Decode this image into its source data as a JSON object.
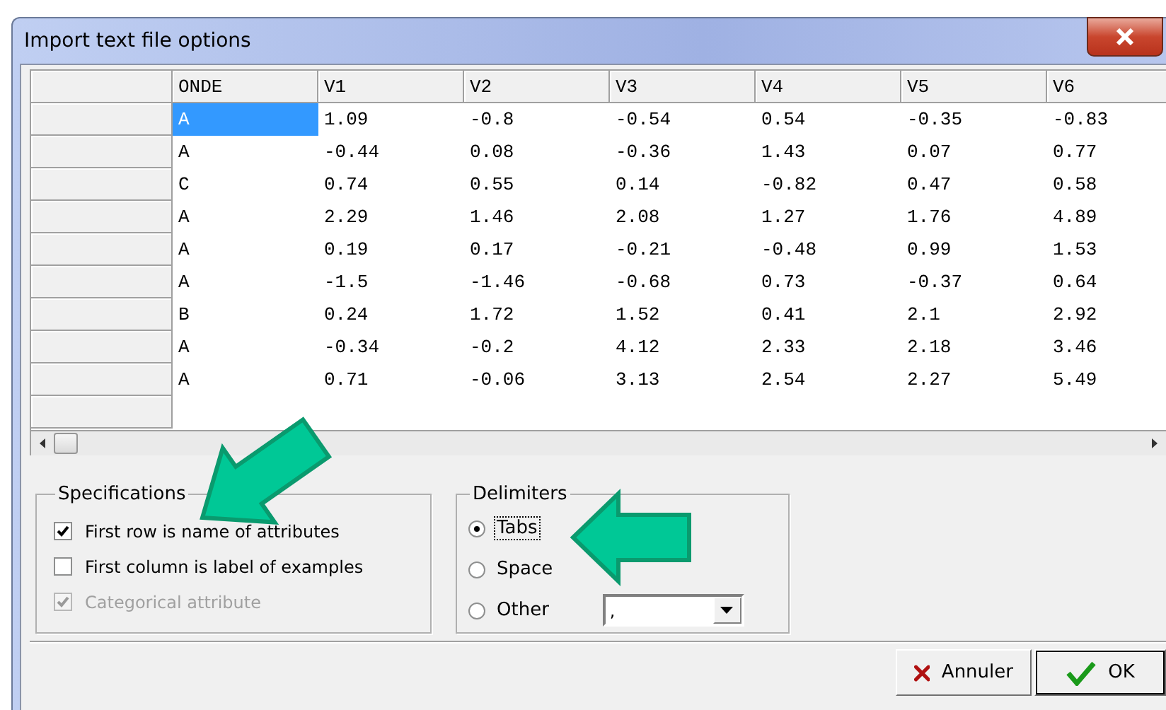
{
  "window": {
    "title": "Import text file options"
  },
  "table": {
    "columns": [
      "ONDE",
      "V1",
      "V2",
      "V3",
      "V4",
      "V5",
      "V6"
    ],
    "rows": [
      {
        "onde": "A",
        "selected": true,
        "values": [
          "1.09",
          "-0.8",
          "-0.54",
          "0.54",
          "-0.35",
          "-0.83"
        ]
      },
      {
        "onde": "A",
        "selected": false,
        "values": [
          "-0.44",
          "0.08",
          "-0.36",
          "1.43",
          "0.07",
          "0.77"
        ]
      },
      {
        "onde": "C",
        "selected": false,
        "values": [
          "0.74",
          "0.55",
          "0.14",
          "-0.82",
          "0.47",
          "0.58"
        ]
      },
      {
        "onde": "A",
        "selected": false,
        "values": [
          "2.29",
          "1.46",
          "2.08",
          "1.27",
          "1.76",
          "4.89"
        ]
      },
      {
        "onde": "A",
        "selected": false,
        "values": [
          "0.19",
          "0.17",
          "-0.21",
          "-0.48",
          "0.99",
          "1.53"
        ]
      },
      {
        "onde": "A",
        "selected": false,
        "values": [
          "-1.5",
          "-1.46",
          "-0.68",
          "0.73",
          "-0.37",
          "0.64"
        ]
      },
      {
        "onde": "B",
        "selected": false,
        "values": [
          "0.24",
          "1.72",
          "1.52",
          "0.41",
          "2.1",
          "2.92"
        ]
      },
      {
        "onde": "A",
        "selected": false,
        "values": [
          "-0.34",
          "-0.2",
          "4.12",
          "2.33",
          "2.18",
          "3.46"
        ]
      },
      {
        "onde": "A",
        "selected": false,
        "values": [
          "0.71",
          "-0.06",
          "3.13",
          "2.54",
          "2.27",
          "5.49"
        ]
      }
    ]
  },
  "specifications": {
    "title": "Specifications",
    "options": [
      {
        "label": "First row is name of attributes",
        "checked": true,
        "disabled": false
      },
      {
        "label": "First column is label of examples",
        "checked": false,
        "disabled": false
      },
      {
        "label": "Categorical attribute",
        "checked": true,
        "disabled": true
      }
    ]
  },
  "delimiters": {
    "title": "Delimiters",
    "options": [
      {
        "label": "Tabs",
        "selected": true
      },
      {
        "label": "Space",
        "selected": false
      },
      {
        "label": "Other",
        "selected": false
      }
    ],
    "other_value": ","
  },
  "buttons": [
    {
      "label": "Annuler",
      "kind": "cancel"
    },
    {
      "label": "OK",
      "kind": "ok"
    }
  ]
}
